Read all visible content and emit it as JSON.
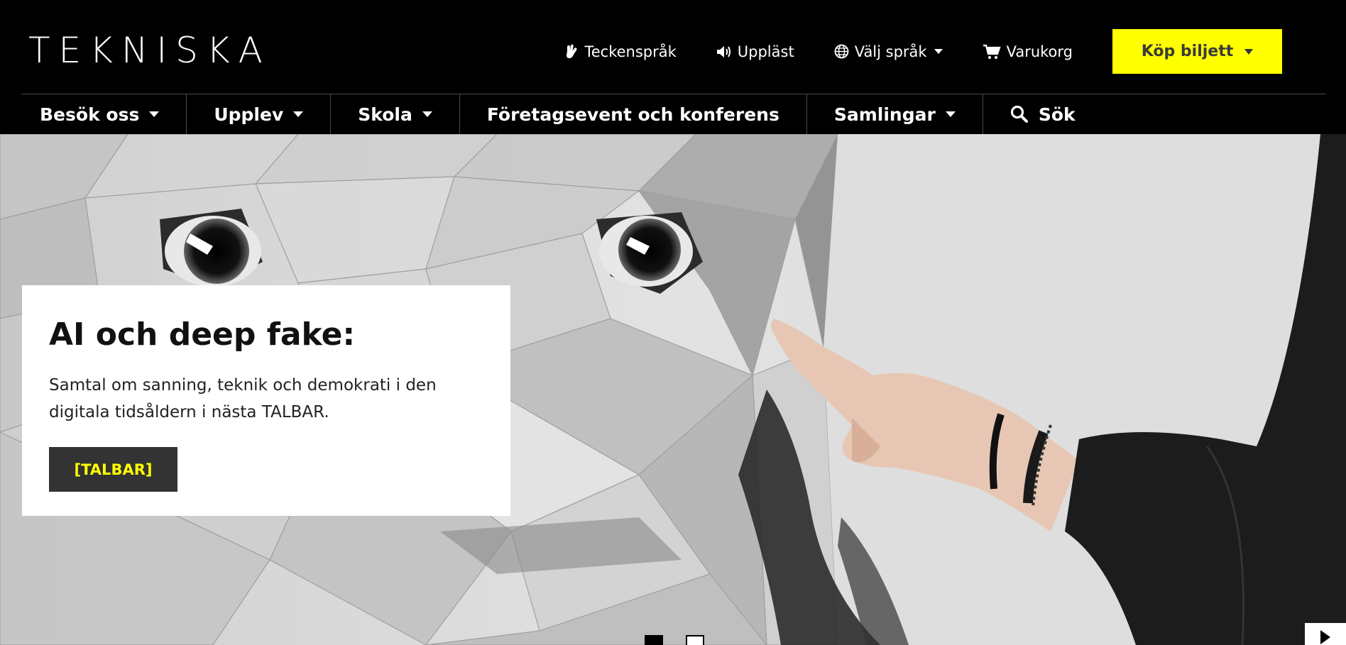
{
  "header": {
    "logo_letters": [
      "T",
      "E",
      "K",
      "N",
      "I",
      "S",
      "K",
      "A"
    ],
    "utility": {
      "sign_language": "Teckenspråk",
      "read_aloud": "Uppläst",
      "language": "Välj språk",
      "cart": "Varukorg"
    },
    "buy_ticket": "Köp biljett"
  },
  "nav": {
    "visit": "Besök oss",
    "experience": "Upplev",
    "school": "Skola",
    "corporate": "Företagsevent och konferens",
    "collections": "Samlingar",
    "search": "Sök"
  },
  "hero": {
    "title": "AI och deep fake:",
    "text": "Samtal om sanning, teknik och demokrati i den digitala tidsåldern i nästa TALBAR.",
    "button": "[TALBAR]",
    "active_slide": 1,
    "slide_count": 2
  },
  "colors": {
    "accent": "#ffff00",
    "header_bg": "#000000",
    "button_dark": "#333333"
  }
}
